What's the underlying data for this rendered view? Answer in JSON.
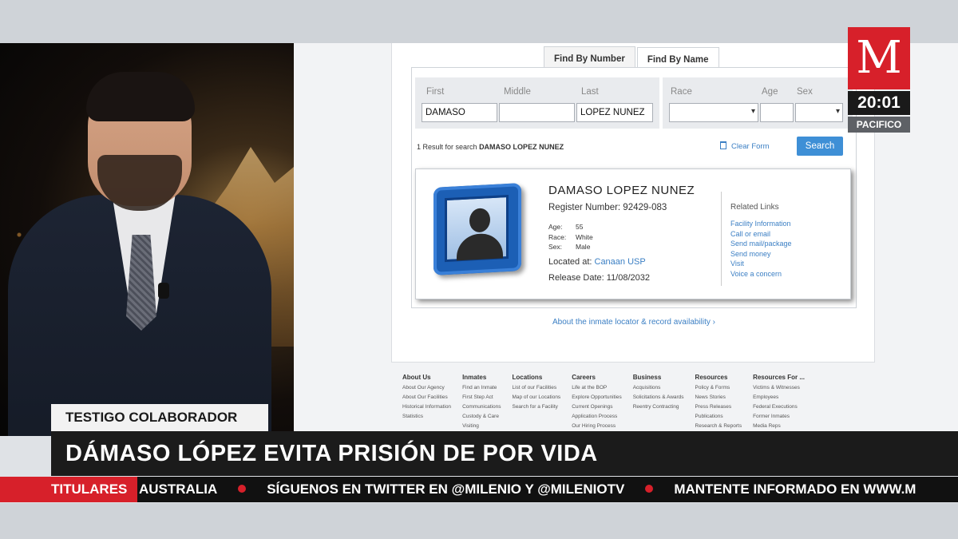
{
  "website": {
    "tabs": [
      "Find By Number",
      "Find By Name"
    ],
    "active_tab": "Find By Name",
    "fields": {
      "first_label": "First",
      "middle_label": "Middle",
      "last_label": "Last",
      "race_label": "Race",
      "age_label": "Age",
      "sex_label": "Sex",
      "first_value": "DAMASO",
      "middle_value": "",
      "last_value": "LOPEZ NUNEZ"
    },
    "results_prefix": "1 Result for search",
    "results_query": "DAMASO LOPEZ NUNEZ",
    "clear_form": "Clear Form",
    "search_button": "Search",
    "inmate": {
      "name": "DAMASO LOPEZ NUNEZ",
      "register": "Register Number: 92429-083",
      "age_key": "Age:",
      "age": "55",
      "race_key": "Race:",
      "race": "White",
      "sex_key": "Sex:",
      "sex": "Male",
      "located_label": "Located at:",
      "located_link": "Canaan USP",
      "release": "Release Date: 11/08/2032"
    },
    "related_title": "Related Links",
    "related_links": [
      "Facility Information",
      "Call or email",
      "Send mail/package",
      "Send money",
      "Visit",
      "Voice a concern"
    ],
    "about_link": "About the inmate locator & record availability ›",
    "footer": [
      {
        "heading": "About Us",
        "items": [
          "About Our Agency",
          "About Our Facilities",
          "Historical Information",
          "Statistics"
        ]
      },
      {
        "heading": "Inmates",
        "items": [
          "Find an Inmate",
          "First Step Act",
          "Communications",
          "Custody & Care",
          "Visiting"
        ]
      },
      {
        "heading": "Locations",
        "items": [
          "List of our Facilities",
          "Map of our Locations",
          "Search for a Facility"
        ]
      },
      {
        "heading": "Careers",
        "items": [
          "Life at the BOP",
          "Explore Opportunities",
          "Current Openings",
          "Application Process",
          "Our Hiring Process"
        ]
      },
      {
        "heading": "Business",
        "items": [
          "Acquisitions",
          "Solicitations & Awards",
          "Reentry Contracting"
        ]
      },
      {
        "heading": "Resources",
        "items": [
          "Policy & Forms",
          "News Stories",
          "Press Releases",
          "Publications",
          "Research & Reports"
        ]
      },
      {
        "heading": "Resources For ...",
        "items": [
          "Victims & Witnesses",
          "Employees",
          "Federal Executions",
          "Former Inmates",
          "Media Reps"
        ]
      }
    ]
  },
  "broadcast": {
    "logo": "M",
    "clock": "20:01",
    "timezone": "PACIFICO",
    "label": "TESTIGO COLABORADOR",
    "headline": "DÁMASO LÓPEZ EVITA PRISIÓN DE POR VIDA",
    "ticker_label": "TITULARES",
    "ticker_items": [
      "AUSTRALIA",
      "SÍGUENOS EN TWITTER EN @MILENIO Y @MILENIOTV",
      "MANTENTE INFORMADO EN WWW.M"
    ]
  },
  "colors": {
    "brand_red": "#d7202a",
    "link_blue": "#3b7fc4",
    "button_blue": "#3e8fd6"
  }
}
